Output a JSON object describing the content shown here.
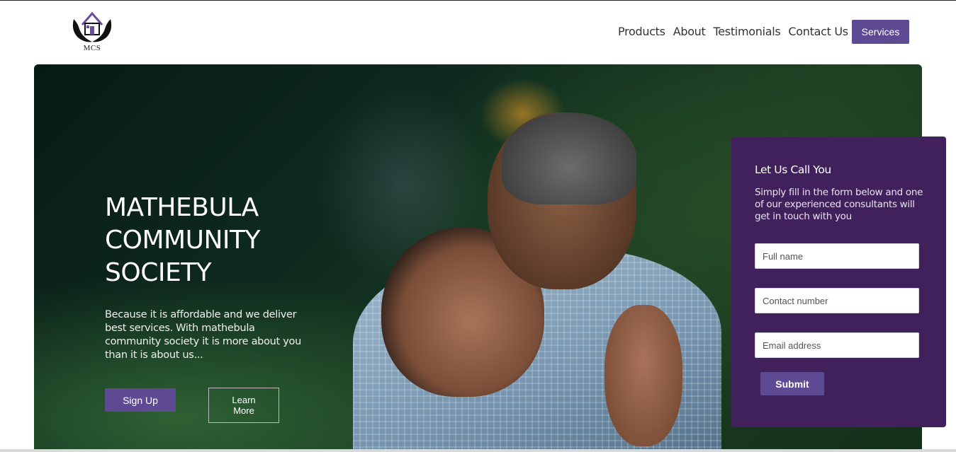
{
  "header": {
    "logo_text": "MCS",
    "nav": [
      "Products",
      "About",
      "Testimonials",
      "Contact Us"
    ],
    "services_label": "Services"
  },
  "hero": {
    "title_lines": [
      "MATHEBULA",
      "COMMUNITY",
      "SOCIETY"
    ],
    "description": "Because it is affordable and we deliver best services. With mathebula community society it is more about you than it is about us...",
    "signup_label": "Sign Up",
    "learn_more_label": "Learn More"
  },
  "form": {
    "title": "Let Us Call You",
    "description": "Simply fill in the form below and one of our experienced consultants will get in touch with you",
    "full_name_placeholder": "Full name",
    "contact_placeholder": "Contact number",
    "email_placeholder": "Email address",
    "submit_label": "Submit"
  },
  "colors": {
    "accent": "#5e4a92",
    "form_bg": "#41215c"
  }
}
